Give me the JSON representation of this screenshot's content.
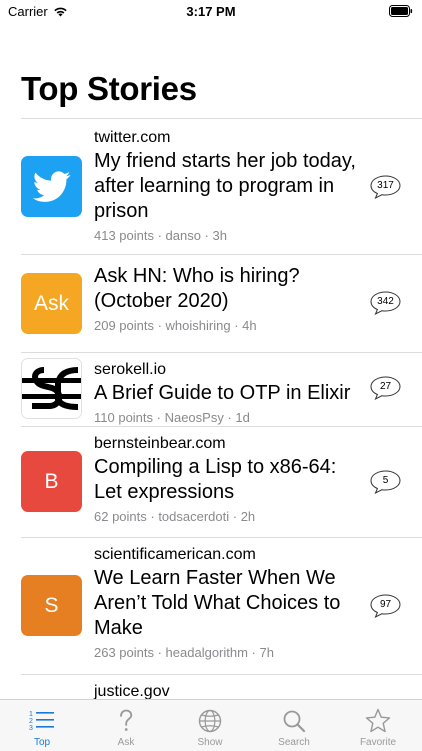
{
  "status_bar": {
    "carrier": "Carrier",
    "time": "3:17 PM"
  },
  "page_title": "Top Stories",
  "stories": [
    {
      "domain": "twitter.com",
      "title": "My friend starts her job today, after learning to program in prison",
      "meta": "413 points · danso · 3h",
      "comments": "317",
      "thumb_icon": "twitter-bird-icon",
      "thumb_text": "",
      "thumb_color": "#1da1f2"
    },
    {
      "domain": "",
      "title": "Ask HN: Who is hiring? (October 2020)",
      "meta": "209 points · whoishiring · 4h",
      "comments": "342",
      "thumb_icon": "",
      "thumb_text": "Ask",
      "thumb_color": "#f5a623"
    },
    {
      "domain": "serokell.io",
      "title": "A Brief Guide to OTP in Elixir",
      "meta": "110 points · NaeosPsy · 1d",
      "comments": "27",
      "thumb_icon": "serokell-logo-icon",
      "thumb_text": "",
      "thumb_color": "#ffffff"
    },
    {
      "domain": "bernsteinbear.com",
      "title": "Compiling a Lisp to x86-64: Let expressions",
      "meta": "62 points · todsacerdoti · 2h",
      "comments": "5",
      "thumb_icon": "",
      "thumb_text": "B",
      "thumb_color": "#e8493e"
    },
    {
      "domain": "scientificamerican.com",
      "title": "We Learn Faster When We Aren’t Told What Choices to Make",
      "meta": "263 points · headalgorithm · 7h",
      "comments": "97",
      "thumb_icon": "",
      "thumb_text": "S",
      "thumb_color": "#e67e22"
    },
    {
      "domain": "justice.gov",
      "title": "",
      "meta": "",
      "comments": "",
      "thumb_icon": "",
      "thumb_text": "",
      "thumb_color": ""
    }
  ],
  "tabs": [
    {
      "label": "Top",
      "icon": "list-numbered-icon",
      "active": true
    },
    {
      "label": "Ask",
      "icon": "question-mark-icon",
      "active": false
    },
    {
      "label": "Show",
      "icon": "globe-icon",
      "active": false
    },
    {
      "label": "Search",
      "icon": "magnifier-icon",
      "active": false
    },
    {
      "label": "Favorite",
      "icon": "star-icon",
      "active": false
    }
  ],
  "colors": {
    "accent": "#1a78d6",
    "inactive_tab": "#999999",
    "meta_text": "#8a8a8e"
  }
}
